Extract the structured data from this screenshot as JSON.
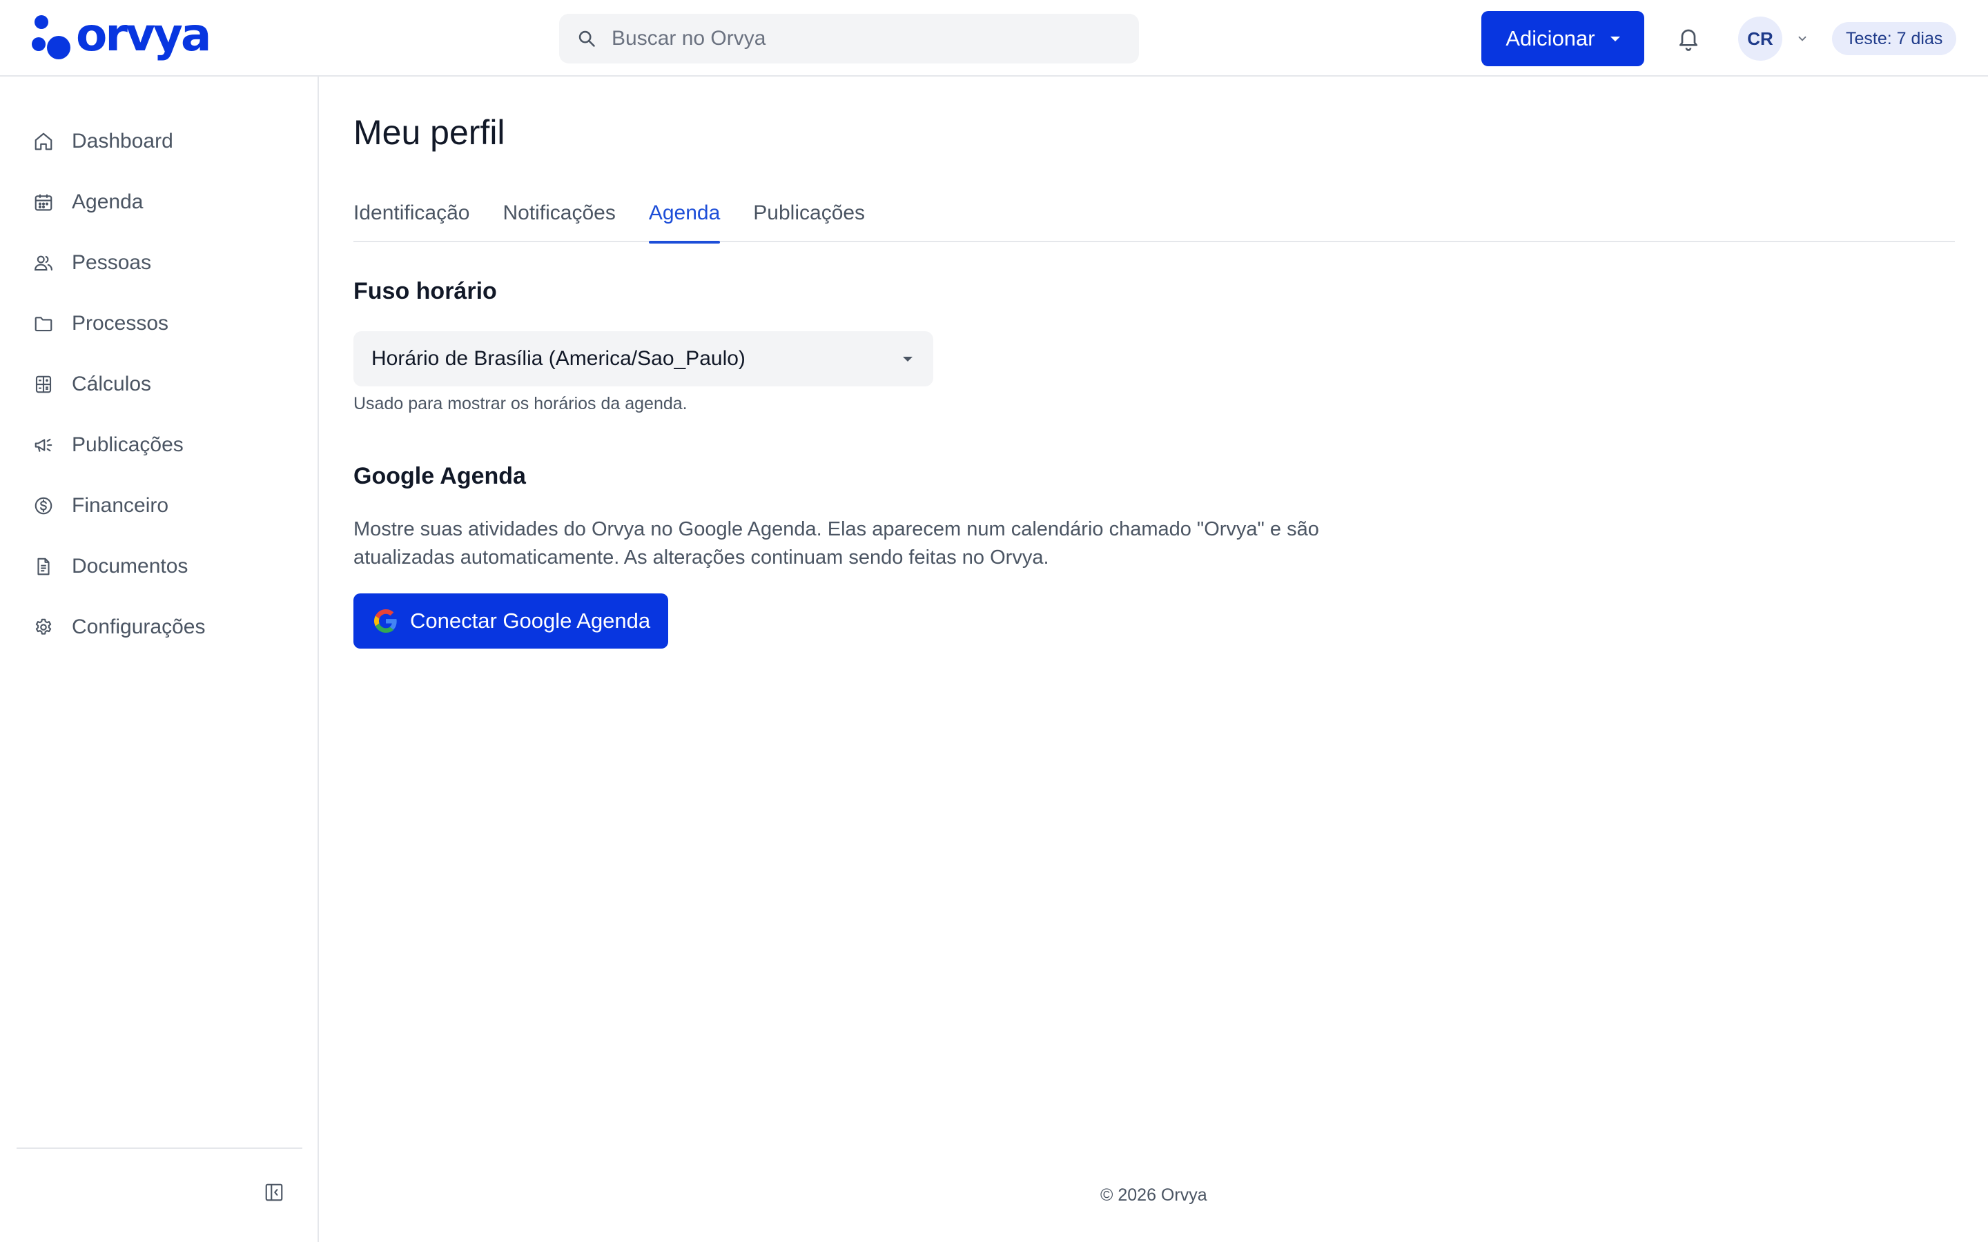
{
  "brand": {
    "name": "orvya",
    "color": "#0836e0"
  },
  "header": {
    "search_placeholder": "Buscar no Orvya",
    "add_label": "Adicionar",
    "avatar_initials": "CR",
    "trial_badge": "Teste: 7 dias",
    "icons": [
      "search-icon",
      "chevron-down-icon",
      "bell-icon"
    ]
  },
  "sidebar": {
    "items": [
      {
        "label": "Dashboard",
        "icon": "home-icon"
      },
      {
        "label": "Agenda",
        "icon": "calendar-icon"
      },
      {
        "label": "Pessoas",
        "icon": "people-icon"
      },
      {
        "label": "Processos",
        "icon": "folder-icon"
      },
      {
        "label": "Cálculos",
        "icon": "calculator-icon"
      },
      {
        "label": "Publicações",
        "icon": "megaphone-icon"
      },
      {
        "label": "Financeiro",
        "icon": "dollar-icon"
      },
      {
        "label": "Documentos",
        "icon": "document-icon"
      },
      {
        "label": "Configurações",
        "icon": "gear-icon"
      }
    ],
    "collapse_icon": "sidebar-collapse-icon"
  },
  "main": {
    "title": "Meu perfil",
    "tabs": [
      {
        "label": "Identificação",
        "active": false
      },
      {
        "label": "Notificações",
        "active": false
      },
      {
        "label": "Agenda",
        "active": true
      },
      {
        "label": "Publicações",
        "active": false
      }
    ],
    "timezone": {
      "title": "Fuso horário",
      "selected": "Horário de Brasília (America/Sao_Paulo)",
      "hint": "Usado para mostrar os horários da agenda."
    },
    "google": {
      "title": "Google Agenda",
      "description": "Mostre suas atividades do Orvya no Google Agenda. Elas aparecem num calendário chamado \"Orvya\" e são atualizadas automaticamente. As alterações continuam sendo feitas no Orvya.",
      "button_label": "Conectar Google Agenda",
      "button_icon": "google-icon"
    }
  },
  "footer": {
    "text": "© 2026 Orvya"
  }
}
